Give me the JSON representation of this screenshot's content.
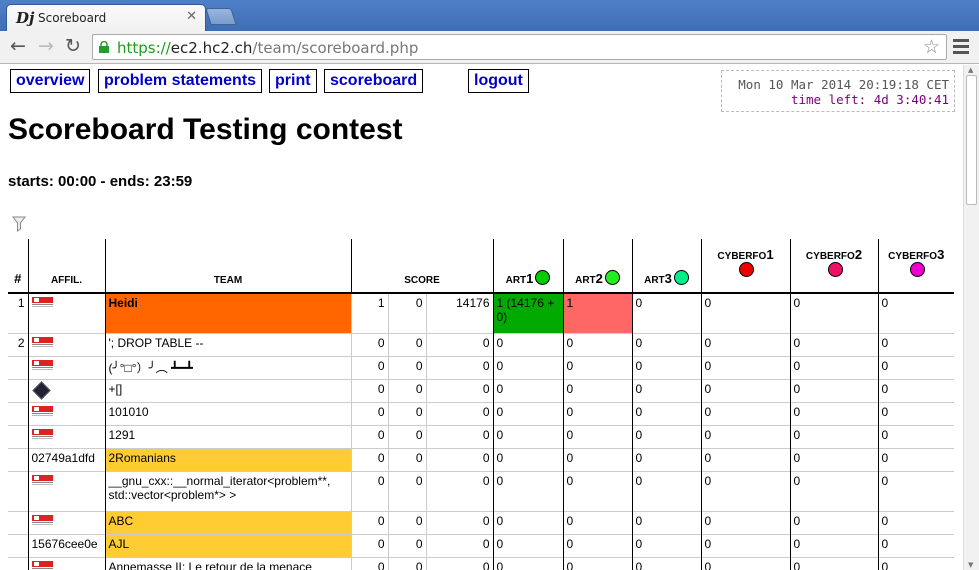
{
  "browser": {
    "tab_title": "Scoreboard",
    "favicon_text": "Dj",
    "url_scheme": "https://",
    "url_host": "ec2.hc2.ch",
    "url_path": "/team/scoreboard.php"
  },
  "nav": {
    "overview": "overview",
    "problem_statements": "problem statements",
    "print": "print",
    "scoreboard": "scoreboard",
    "logout": "logout"
  },
  "clock": {
    "now": "Mon 10 Mar 2014 20:19:18 CET",
    "time_left": "time left: 4d 3:40:41"
  },
  "title": "Scoreboard Testing contest",
  "times": "starts: 00:00 - ends: 23:59",
  "columns": {
    "rank": "#",
    "affiliation": "AFFIL.",
    "team": "TEAM",
    "score": "SCORE"
  },
  "problems": [
    {
      "prefix": "ART",
      "num": "1",
      "color": "#00cc00"
    },
    {
      "prefix": "ART",
      "num": "2",
      "color": "#22ee22"
    },
    {
      "prefix": "ART",
      "num": "3",
      "color": "#00ee88"
    },
    {
      "prefix": "CYBERFO",
      "num": "1",
      "color": "#ee0000"
    },
    {
      "prefix": "CYBERFO",
      "num": "2",
      "color": "#ee1166"
    },
    {
      "prefix": "CYBERFO",
      "num": "3",
      "color": "#ee00cc"
    }
  ],
  "colors": {
    "highlight_team": "#ff6600",
    "category_team": "#ffcc33",
    "solved_cell": "#00aa00",
    "failed_cell": "#ff6666",
    "link": "#0000cc"
  },
  "rows": [
    {
      "rank": "1",
      "affil": "logo",
      "team": "Heidi",
      "bold": true,
      "team_bg": "#ff6600",
      "solved": "1",
      "penalty": "0",
      "time": "14176",
      "cells": [
        "1 (14176 + 0)",
        "1",
        "0",
        "0",
        "0",
        "0"
      ],
      "cell_bg": [
        "#00aa00",
        "#ff6666",
        "",
        "",
        "",
        ""
      ],
      "sep": false
    },
    {
      "rank": "2",
      "affil": "logo",
      "team": "'; DROP TABLE --",
      "team_bg": "",
      "solved": "0",
      "penalty": "0",
      "time": "0",
      "cells": [
        "0",
        "0",
        "0",
        "0",
        "0",
        "0"
      ],
      "sep": true
    },
    {
      "rank": "",
      "affil": "logo",
      "team": "(╯°□°）╯︵ ┻━┻",
      "team_bg": "",
      "solved": "0",
      "penalty": "0",
      "time": "0",
      "cells": [
        "0",
        "0",
        "0",
        "0",
        "0",
        "0"
      ],
      "sep": true
    },
    {
      "rank": "",
      "affil": "cube",
      "team": "+[]",
      "team_bg": "",
      "solved": "0",
      "penalty": "0",
      "time": "0",
      "cells": [
        "0",
        "0",
        "0",
        "0",
        "0",
        "0"
      ],
      "sep": true
    },
    {
      "rank": "",
      "affil": "logo",
      "team": "101010",
      "team_bg": "",
      "solved": "0",
      "penalty": "0",
      "time": "0",
      "cells": [
        "0",
        "0",
        "0",
        "0",
        "0",
        "0"
      ],
      "sep": true
    },
    {
      "rank": "",
      "affil": "logo",
      "team": "1291",
      "team_bg": "",
      "solved": "0",
      "penalty": "0",
      "time": "0",
      "cells": [
        "0",
        "0",
        "0",
        "0",
        "0",
        "0"
      ],
      "sep": true
    },
    {
      "rank": "",
      "affil": "02749a1dfd",
      "team": "2Romanians",
      "team_bg": "#ffcc33",
      "solved": "0",
      "penalty": "0",
      "time": "0",
      "cells": [
        "0",
        "0",
        "0",
        "0",
        "0",
        "0"
      ],
      "sep": true
    },
    {
      "rank": "",
      "affil": "logo",
      "team": "__gnu_cxx::__normal_iterator<problem**, std::vector<problem*> >",
      "team_bg": "",
      "tall": true,
      "solved": "0",
      "penalty": "0",
      "time": "0",
      "cells": [
        "0",
        "0",
        "0",
        "0",
        "0",
        "0"
      ],
      "sep": true
    },
    {
      "rank": "",
      "affil": "logo",
      "team": "ABC",
      "team_bg": "#ffcc33",
      "solved": "0",
      "penalty": "0",
      "time": "0",
      "cells": [
        "0",
        "0",
        "0",
        "0",
        "0",
        "0"
      ],
      "sep": true
    },
    {
      "rank": "",
      "affil": "15676cee0e",
      "team": "AJL",
      "team_bg": "#ffcc33",
      "solved": "0",
      "penalty": "0",
      "time": "0",
      "cells": [
        "0",
        "0",
        "0",
        "0",
        "0",
        "0"
      ],
      "sep": true
    },
    {
      "rank": "",
      "affil": "logo",
      "team": "Annemasse II: Le retour de la menace",
      "team_bg": "",
      "solved": "0",
      "penalty": "0",
      "time": "0",
      "cells": [
        "0",
        "0",
        "0",
        "0",
        "0",
        "0"
      ],
      "sep": true
    }
  ]
}
